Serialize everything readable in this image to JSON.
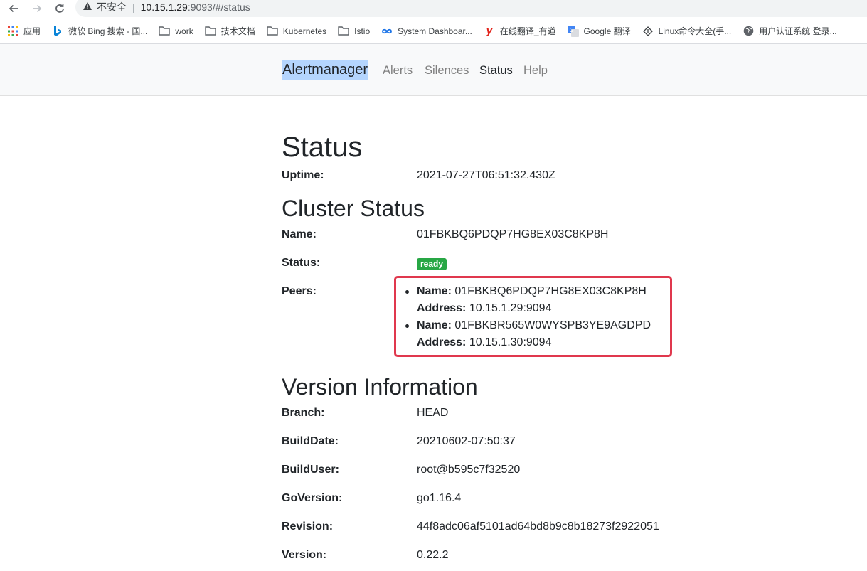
{
  "browser": {
    "omnibox": {
      "security_label": "不安全",
      "host": "10.15.1.29",
      "path": ":9093/#/status"
    },
    "bookmarks": [
      {
        "label": "应用",
        "icon": "apps-grid-icon"
      },
      {
        "label": "微软 Bing 搜索 - 国...",
        "icon": "bing-icon"
      },
      {
        "label": "work",
        "icon": "folder-icon"
      },
      {
        "label": "技术文档",
        "icon": "folder-icon"
      },
      {
        "label": "Kubernetes",
        "icon": "folder-icon"
      },
      {
        "label": "Istio",
        "icon": "folder-icon"
      },
      {
        "label": "System Dashboar...",
        "icon": "infinity-icon"
      },
      {
        "label": "在线翻译_有道",
        "icon": "youdao-icon"
      },
      {
        "label": "Google 翻译",
        "icon": "google-translate-icon"
      },
      {
        "label": "Linux命令大全(手...",
        "icon": "linux-icon"
      },
      {
        "label": "用户认证系统 登录...",
        "icon": "globe-icon"
      }
    ]
  },
  "nav": {
    "brand": "Alertmanager",
    "links": [
      "Alerts",
      "Silences",
      "Status",
      "Help"
    ],
    "active": "Status"
  },
  "status": {
    "title": "Status",
    "uptime_label": "Uptime:",
    "uptime_value": "2021-07-27T06:51:32.430Z"
  },
  "cluster": {
    "title": "Cluster Status",
    "name_label": "Name:",
    "name_value": "01FBKBQ6PDQP7HG8EX03C8KP8H",
    "status_label": "Status:",
    "status_value": "ready",
    "status_color": "#28a745",
    "peers_label": "Peers:",
    "peers": [
      {
        "name_label": "Name:",
        "name": "01FBKBQ6PDQP7HG8EX03C8KP8H",
        "address_label": "Address:",
        "address": "10.15.1.29:9094"
      },
      {
        "name_label": "Name:",
        "name": "01FBKBR565W0WYSPB3YE9AGDPD",
        "address_label": "Address:",
        "address": "10.15.1.30:9094"
      }
    ],
    "highlight_color": "#e0384d"
  },
  "version": {
    "title": "Version Information",
    "rows": [
      {
        "label": "Branch:",
        "value": "HEAD"
      },
      {
        "label": "BuildDate:",
        "value": "20210602-07:50:37"
      },
      {
        "label": "BuildUser:",
        "value": "root@b595c7f32520"
      },
      {
        "label": "GoVersion:",
        "value": "go1.16.4"
      },
      {
        "label": "Revision:",
        "value": "44f8adc06af5101ad64bd8b9c8b18273f2922051"
      },
      {
        "label": "Version:",
        "value": "0.22.2"
      }
    ]
  }
}
